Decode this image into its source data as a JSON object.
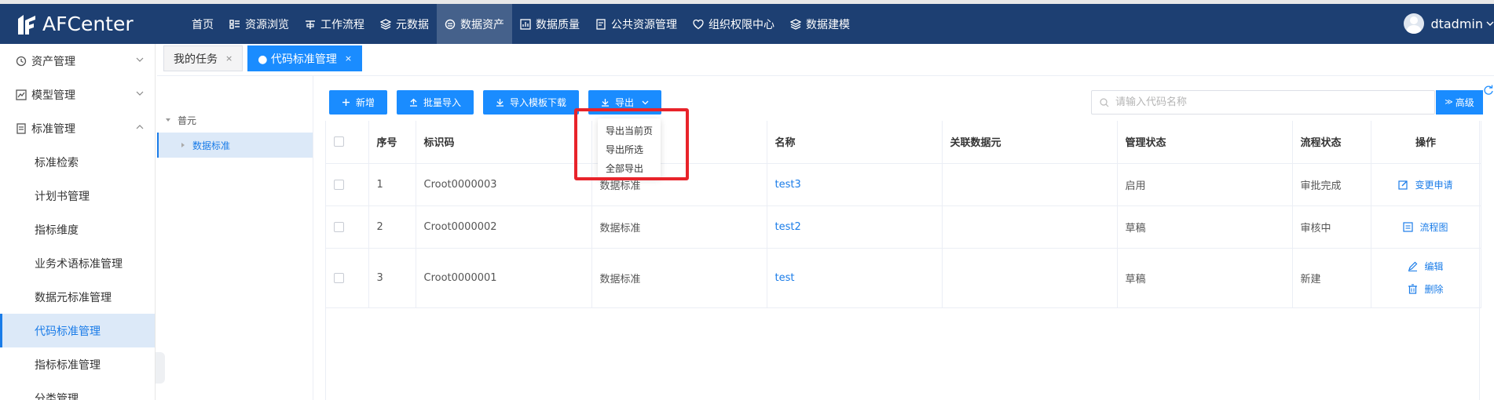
{
  "app": {
    "title": "AFCenter"
  },
  "nav": [
    {
      "label": "首页",
      "icon": "none"
    },
    {
      "label": "资源浏览",
      "icon": "list-icon"
    },
    {
      "label": "工作流程",
      "icon": "workflow-icon"
    },
    {
      "label": "元数据",
      "icon": "layers-icon"
    },
    {
      "label": "数据资产",
      "icon": "asset-icon",
      "active": true
    },
    {
      "label": "数据质量",
      "icon": "chart-icon"
    },
    {
      "label": "公共资源管理",
      "icon": "document-icon"
    },
    {
      "label": "组织权限中心",
      "icon": "shield-icon"
    },
    {
      "label": "数据建模",
      "icon": "stack-icon"
    }
  ],
  "user": {
    "name": "dtadmin"
  },
  "sidebar": {
    "groups": [
      {
        "label": "资产管理",
        "icon": "clock-icon"
      },
      {
        "label": "模型管理",
        "icon": "chart-icon"
      },
      {
        "label": "标准管理",
        "icon": "document-icon"
      }
    ],
    "items": [
      "标准检索",
      "计划书管理",
      "指标维度",
      "业务术语标准管理",
      "数据元标准管理",
      "代码标准管理",
      "指标标准管理",
      "分类管理"
    ],
    "active_item": "代码标准管理"
  },
  "tabs": [
    {
      "label": "我的任务",
      "close": "×"
    },
    {
      "label": "● 代码标准管理",
      "close": "×",
      "active": true
    }
  ],
  "tree": {
    "root": "普元",
    "child": "数据标准"
  },
  "toolbar": {
    "add": "新增",
    "batch_import": "批量导入",
    "template_download": "导入模板下载",
    "export": "导出"
  },
  "export_menu": [
    "导出当前页",
    "导出所选",
    "全部导出"
  ],
  "search": {
    "placeholder": "请输入代码名称",
    "advanced": "高级"
  },
  "table": {
    "headers": [
      "序号",
      "标识码",
      "",
      "名称",
      "关联数据元",
      "管理状态",
      "流程状态",
      "操作"
    ],
    "rows": [
      {
        "no": "1",
        "code": "Croot0000003",
        "category": "数据标准",
        "name": "test3",
        "linked": "",
        "status": "启用",
        "flow": "审批完成",
        "ops": [
          "变更申请"
        ]
      },
      {
        "no": "2",
        "code": "Croot0000002",
        "category": "数据标准",
        "name": "test2",
        "linked": "",
        "status": "草稿",
        "flow": "审核中",
        "ops": [
          "流程图"
        ]
      },
      {
        "no": "3",
        "code": "Croot0000001",
        "category": "数据标准",
        "name": "test",
        "linked": "",
        "status": "草稿",
        "flow": "新建",
        "ops": [
          "编辑",
          "删除"
        ]
      }
    ]
  },
  "colors": {
    "header_bg": "#1d3f72",
    "primary": "#1a8cff",
    "link": "#1a7ce8",
    "highlight": "#e8232a"
  }
}
